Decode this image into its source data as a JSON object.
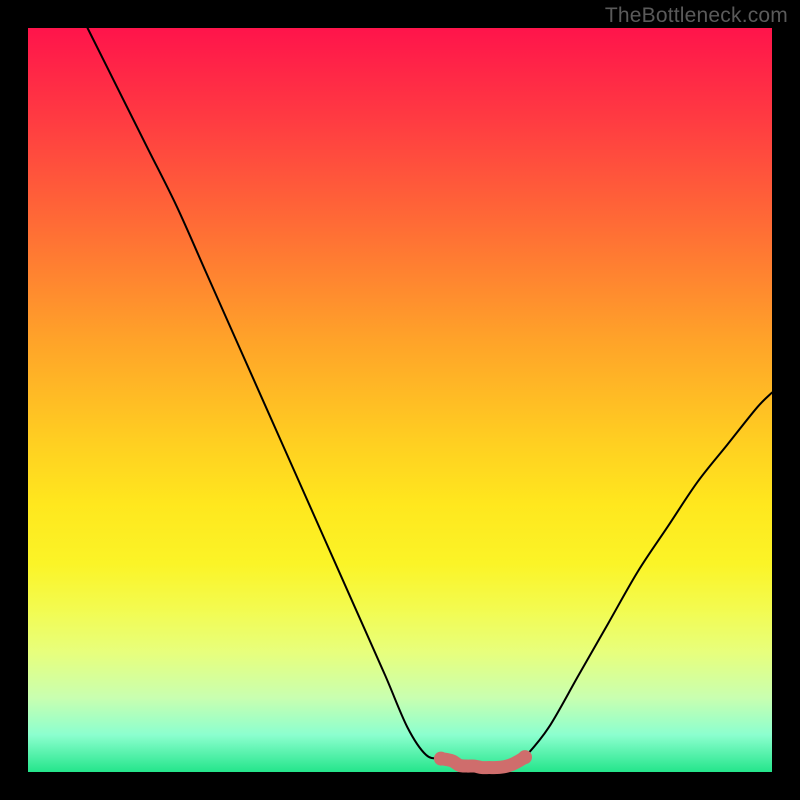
{
  "watermark": "TheBottleneck.com",
  "chart_data": {
    "type": "line",
    "title": "",
    "xlabel": "",
    "ylabel": "",
    "xlim": [
      0,
      100
    ],
    "ylim": [
      0,
      100
    ],
    "grid": false,
    "legend": false,
    "series": [
      {
        "name": "left-curve",
        "x": [
          8,
          12,
          16,
          20,
          24,
          28,
          32,
          36,
          40,
          44,
          48,
          51,
          53.5,
          55.5
        ],
        "y": [
          100,
          92,
          84,
          76,
          67,
          58,
          49,
          40,
          31,
          22,
          13,
          6,
          2.3,
          1.8
        ]
      },
      {
        "name": "bottom-segment",
        "x": [
          55.5,
          57,
          58,
          59,
          60,
          61,
          62,
          63,
          64,
          65,
          66,
          66.8
        ],
        "y": [
          1.8,
          1.5,
          0.9,
          0.8,
          0.8,
          0.6,
          0.6,
          0.6,
          0.7,
          1.0,
          1.5,
          2.0
        ]
      },
      {
        "name": "right-curve",
        "x": [
          66.8,
          70,
          74,
          78,
          82,
          86,
          90,
          94,
          98,
          100
        ],
        "y": [
          2.0,
          6,
          13,
          20,
          27,
          33,
          39,
          44,
          49,
          51
        ]
      }
    ],
    "highlight": {
      "name": "bottom-highlight",
      "color": "#cf6d6c",
      "x_range": [
        55.5,
        66.8
      ]
    }
  }
}
